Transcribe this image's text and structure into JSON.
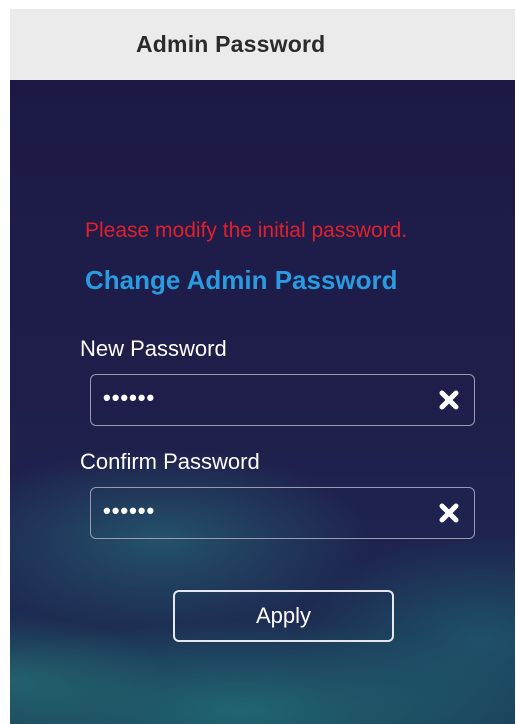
{
  "window": {
    "title": "Admin Password"
  },
  "form": {
    "warning": "Please modify the initial password.",
    "heading": "Change Admin Password",
    "new_password": {
      "label": "New Password",
      "value": "••••••",
      "clear_icon": "close-icon"
    },
    "confirm_password": {
      "label": "Confirm Password",
      "value": "••••••",
      "clear_icon": "close-icon"
    },
    "apply_label": "Apply"
  },
  "colors": {
    "warning": "#e0202e",
    "heading": "#2a9be0",
    "panel_background": "#1c1a45",
    "titlebar_background": "#ebebeb"
  }
}
